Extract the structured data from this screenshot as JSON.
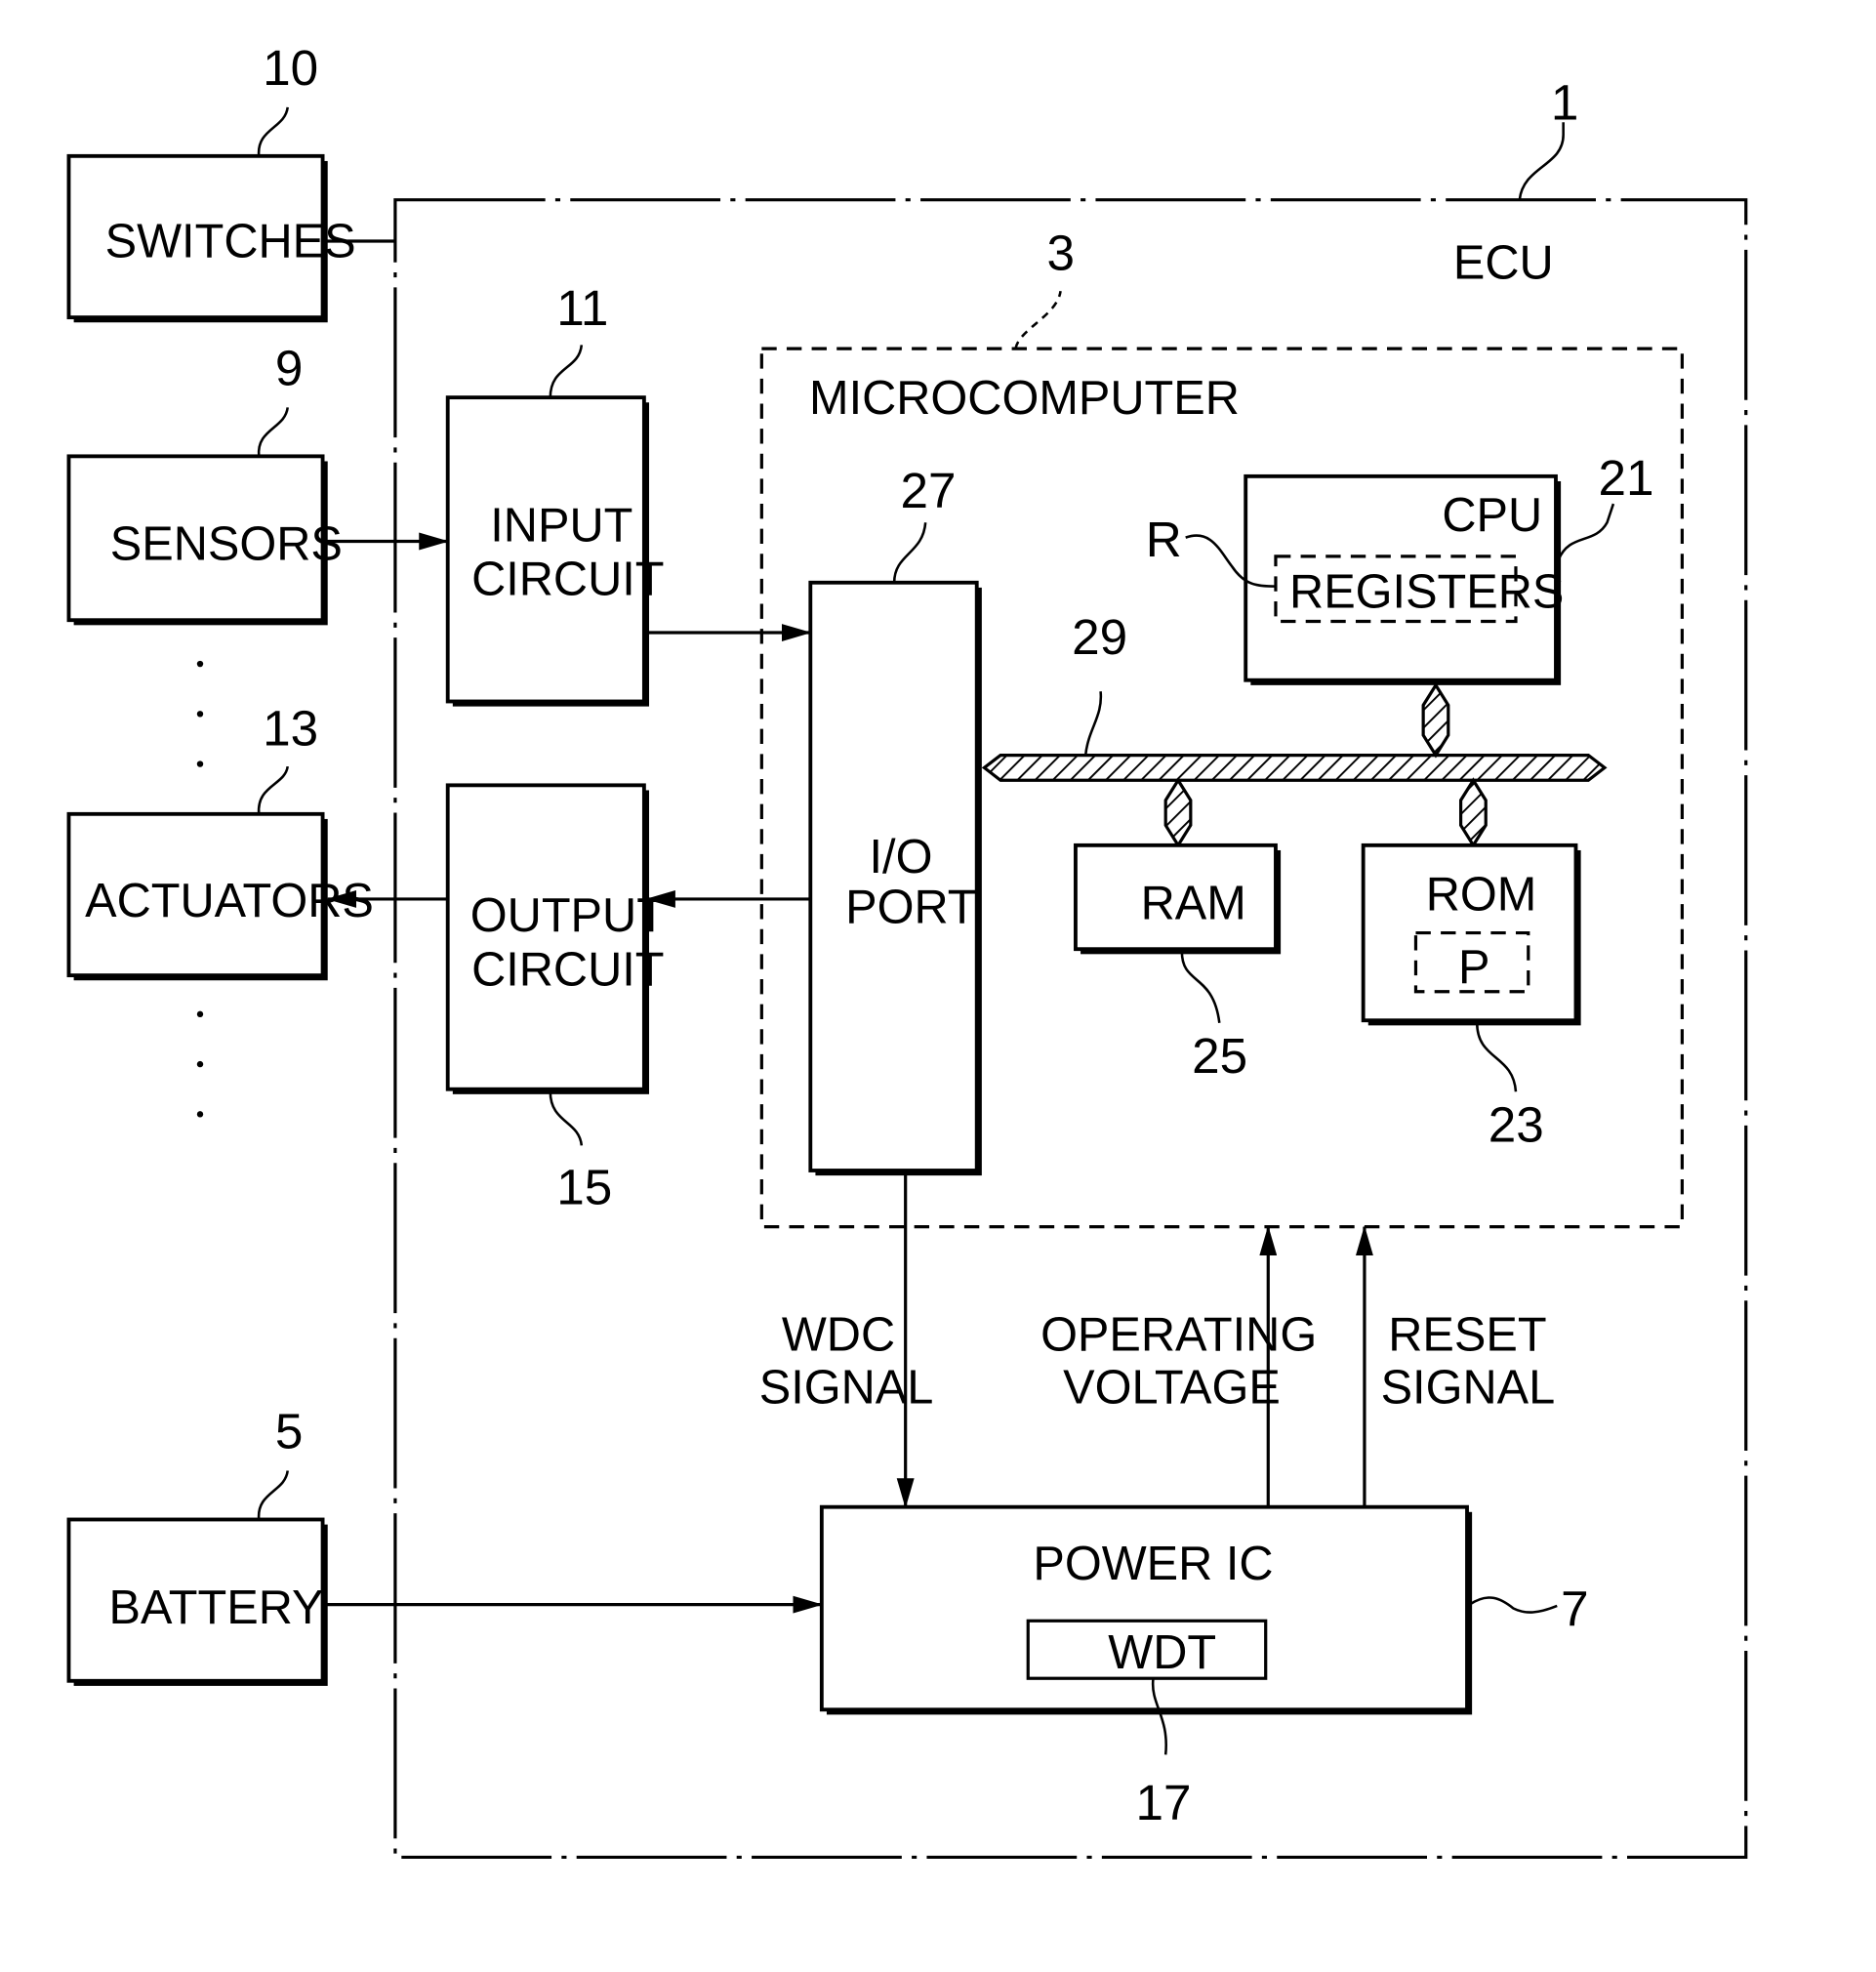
{
  "diagram": {
    "ecu": {
      "label": "ECU",
      "ref": "1"
    },
    "microcomputer": {
      "label": "MICROCOMPUTER",
      "ref": "3"
    },
    "switches": {
      "label": "SWITCHES",
      "ref": "10"
    },
    "sensors": {
      "label": "SENSORS",
      "ref": "9"
    },
    "actuators": {
      "label": "ACTUATORS",
      "ref": "13"
    },
    "battery": {
      "label": "BATTERY",
      "ref": "5"
    },
    "input_circuit": {
      "line1": "INPUT",
      "line2": "CIRCUIT",
      "ref": "11"
    },
    "output_circuit": {
      "line1": "OUTPUT",
      "line2": "CIRCUIT",
      "ref": "15"
    },
    "io_port": {
      "line1": "I/O",
      "line2": "PORT",
      "ref": "27"
    },
    "cpu": {
      "label": "CPU",
      "ref": "21"
    },
    "registers": {
      "label": "REGISTERS",
      "ref": "R"
    },
    "bus": {
      "ref": "29"
    },
    "ram": {
      "label": "RAM",
      "ref": "25"
    },
    "rom": {
      "label": "ROM",
      "ref": "23"
    },
    "program": {
      "label": "P"
    },
    "power_ic": {
      "label": "POWER IC",
      "ref": "7"
    },
    "wdt": {
      "label": "WDT",
      "ref": "17"
    },
    "signals": {
      "wdc": {
        "line1": "WDC",
        "line2": "SIGNAL"
      },
      "operating_voltage": {
        "line1": "OPERATING",
        "line2": "VOLTAGE"
      },
      "reset": {
        "line1": "RESET",
        "line2": "SIGNAL"
      }
    }
  }
}
